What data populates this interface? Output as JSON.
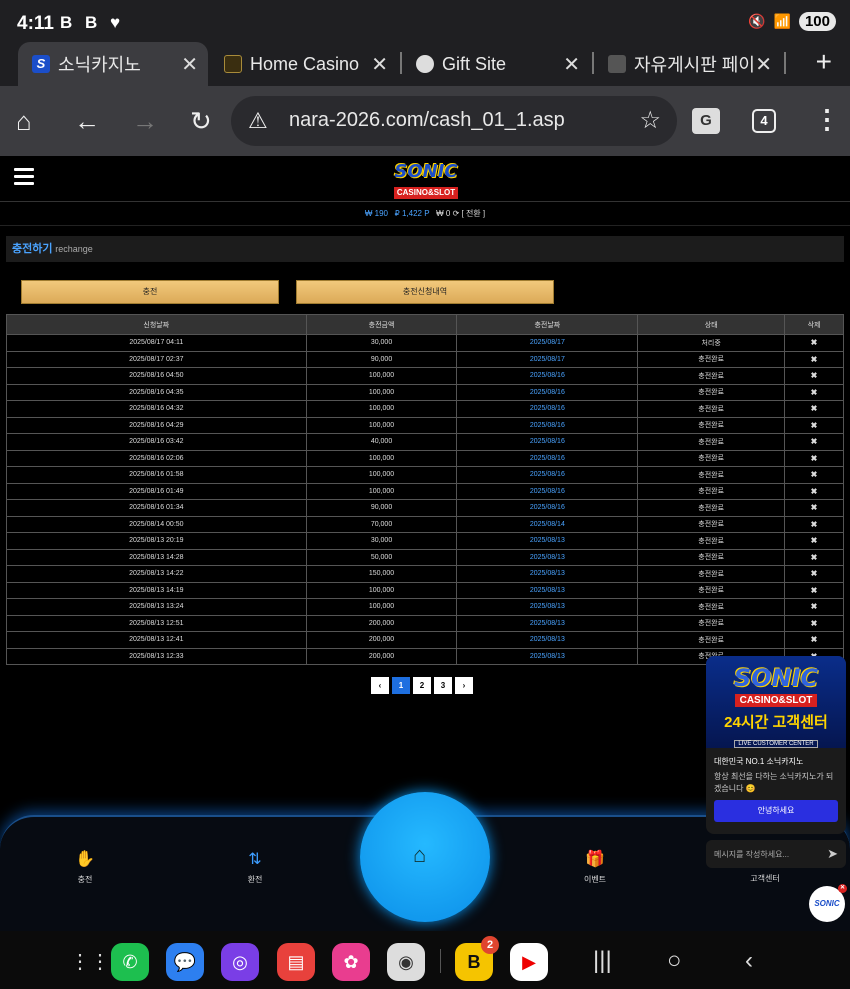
{
  "status_bar": {
    "time": "4:11",
    "left_icons": "B B ♥",
    "battery": "100"
  },
  "tabs": [
    {
      "title": "소닉카지노",
      "active": true
    },
    {
      "title": "Home Casino",
      "active": false
    },
    {
      "title": "Gift Site",
      "active": false
    },
    {
      "title": "자유게시판 페이지",
      "active": false
    }
  ],
  "address_bar": {
    "url": "nara-2026.com/cash_01_1.asp",
    "tab_count": "4"
  },
  "site": {
    "logo_main": "SONIC",
    "logo_sub": "CASINO&SLOT",
    "balance_won": "₩ 190",
    "balance_point": "₽ 1,422 P",
    "balance_extra": "₩ 0",
    "convert_label": "[ 전환 ]"
  },
  "page": {
    "title": "충전하기",
    "subtitle": "rechange",
    "charge_button": "충전",
    "history_button": "충전신청내역"
  },
  "table": {
    "headers": [
      "신청날짜",
      "충전금액",
      "충전날짜",
      "상태",
      "삭제"
    ],
    "rows": [
      [
        "2025/08/17 04:11",
        "30,000",
        "2025/08/17",
        "처리중"
      ],
      [
        "2025/08/17 02:37",
        "90,000",
        "2025/08/17",
        "충전완료"
      ],
      [
        "2025/08/16 04:50",
        "100,000",
        "2025/08/16",
        "충전완료"
      ],
      [
        "2025/08/16 04:35",
        "100,000",
        "2025/08/16",
        "충전완료"
      ],
      [
        "2025/08/16 04:32",
        "100,000",
        "2025/08/16",
        "충전완료"
      ],
      [
        "2025/08/16 04:29",
        "100,000",
        "2025/08/16",
        "충전완료"
      ],
      [
        "2025/08/16 03:42",
        "40,000",
        "2025/08/16",
        "충전완료"
      ],
      [
        "2025/08/16 02:06",
        "100,000",
        "2025/08/16",
        "충전완료"
      ],
      [
        "2025/08/16 01:58",
        "100,000",
        "2025/08/16",
        "충전완료"
      ],
      [
        "2025/08/16 01:49",
        "100,000",
        "2025/08/16",
        "충전완료"
      ],
      [
        "2025/08/16 01:34",
        "90,000",
        "2025/08/16",
        "충전완료"
      ],
      [
        "2025/08/14 00:50",
        "70,000",
        "2025/08/14",
        "충전완료"
      ],
      [
        "2025/08/13 20:19",
        "30,000",
        "2025/08/13",
        "충전완료"
      ],
      [
        "2025/08/13 14:28",
        "50,000",
        "2025/08/13",
        "충전완료"
      ],
      [
        "2025/08/13 14:22",
        "150,000",
        "2025/08/13",
        "충전완료"
      ],
      [
        "2025/08/13 14:19",
        "100,000",
        "2025/08/13",
        "충전완료"
      ],
      [
        "2025/08/13 13:24",
        "100,000",
        "2025/08/13",
        "충전완료"
      ],
      [
        "2025/08/13 12:51",
        "200,000",
        "2025/08/13",
        "충전완료"
      ],
      [
        "2025/08/13 12:41",
        "200,000",
        "2025/08/13",
        "충전완료"
      ],
      [
        "2025/08/13 12:33",
        "200,000",
        "2025/08/13",
        "충전완료"
      ]
    ],
    "delete_glyph": "✖"
  },
  "pagination": {
    "prev": "‹",
    "pages": [
      "1",
      "2",
      "3"
    ],
    "current": "1",
    "next": "›"
  },
  "bottom_nav": {
    "charge": "충전",
    "exchange": "환전",
    "event": "이벤트",
    "support": "고객센터"
  },
  "chat": {
    "banner_main": "SONIC",
    "banner_sub": "CASINO&SLOT",
    "banner_title": "24시간 고객센터",
    "banner_caption": "LIVE CUSTOMER CENTER",
    "title": "대한민국 NO.1 소닉카지노",
    "message": "항상 최선을 다하는 소닉카지노가 되겠습니다 😊",
    "button": "안녕하세요",
    "input_placeholder": "메시지를 작성하세요...",
    "bubble_logo": "SONIC"
  },
  "dock": {
    "badge_count": "2"
  },
  "colors": {
    "accent_blue": "#4aa3ff",
    "gold_button": "#e8b96a",
    "home_circle": "#19a9f7"
  }
}
